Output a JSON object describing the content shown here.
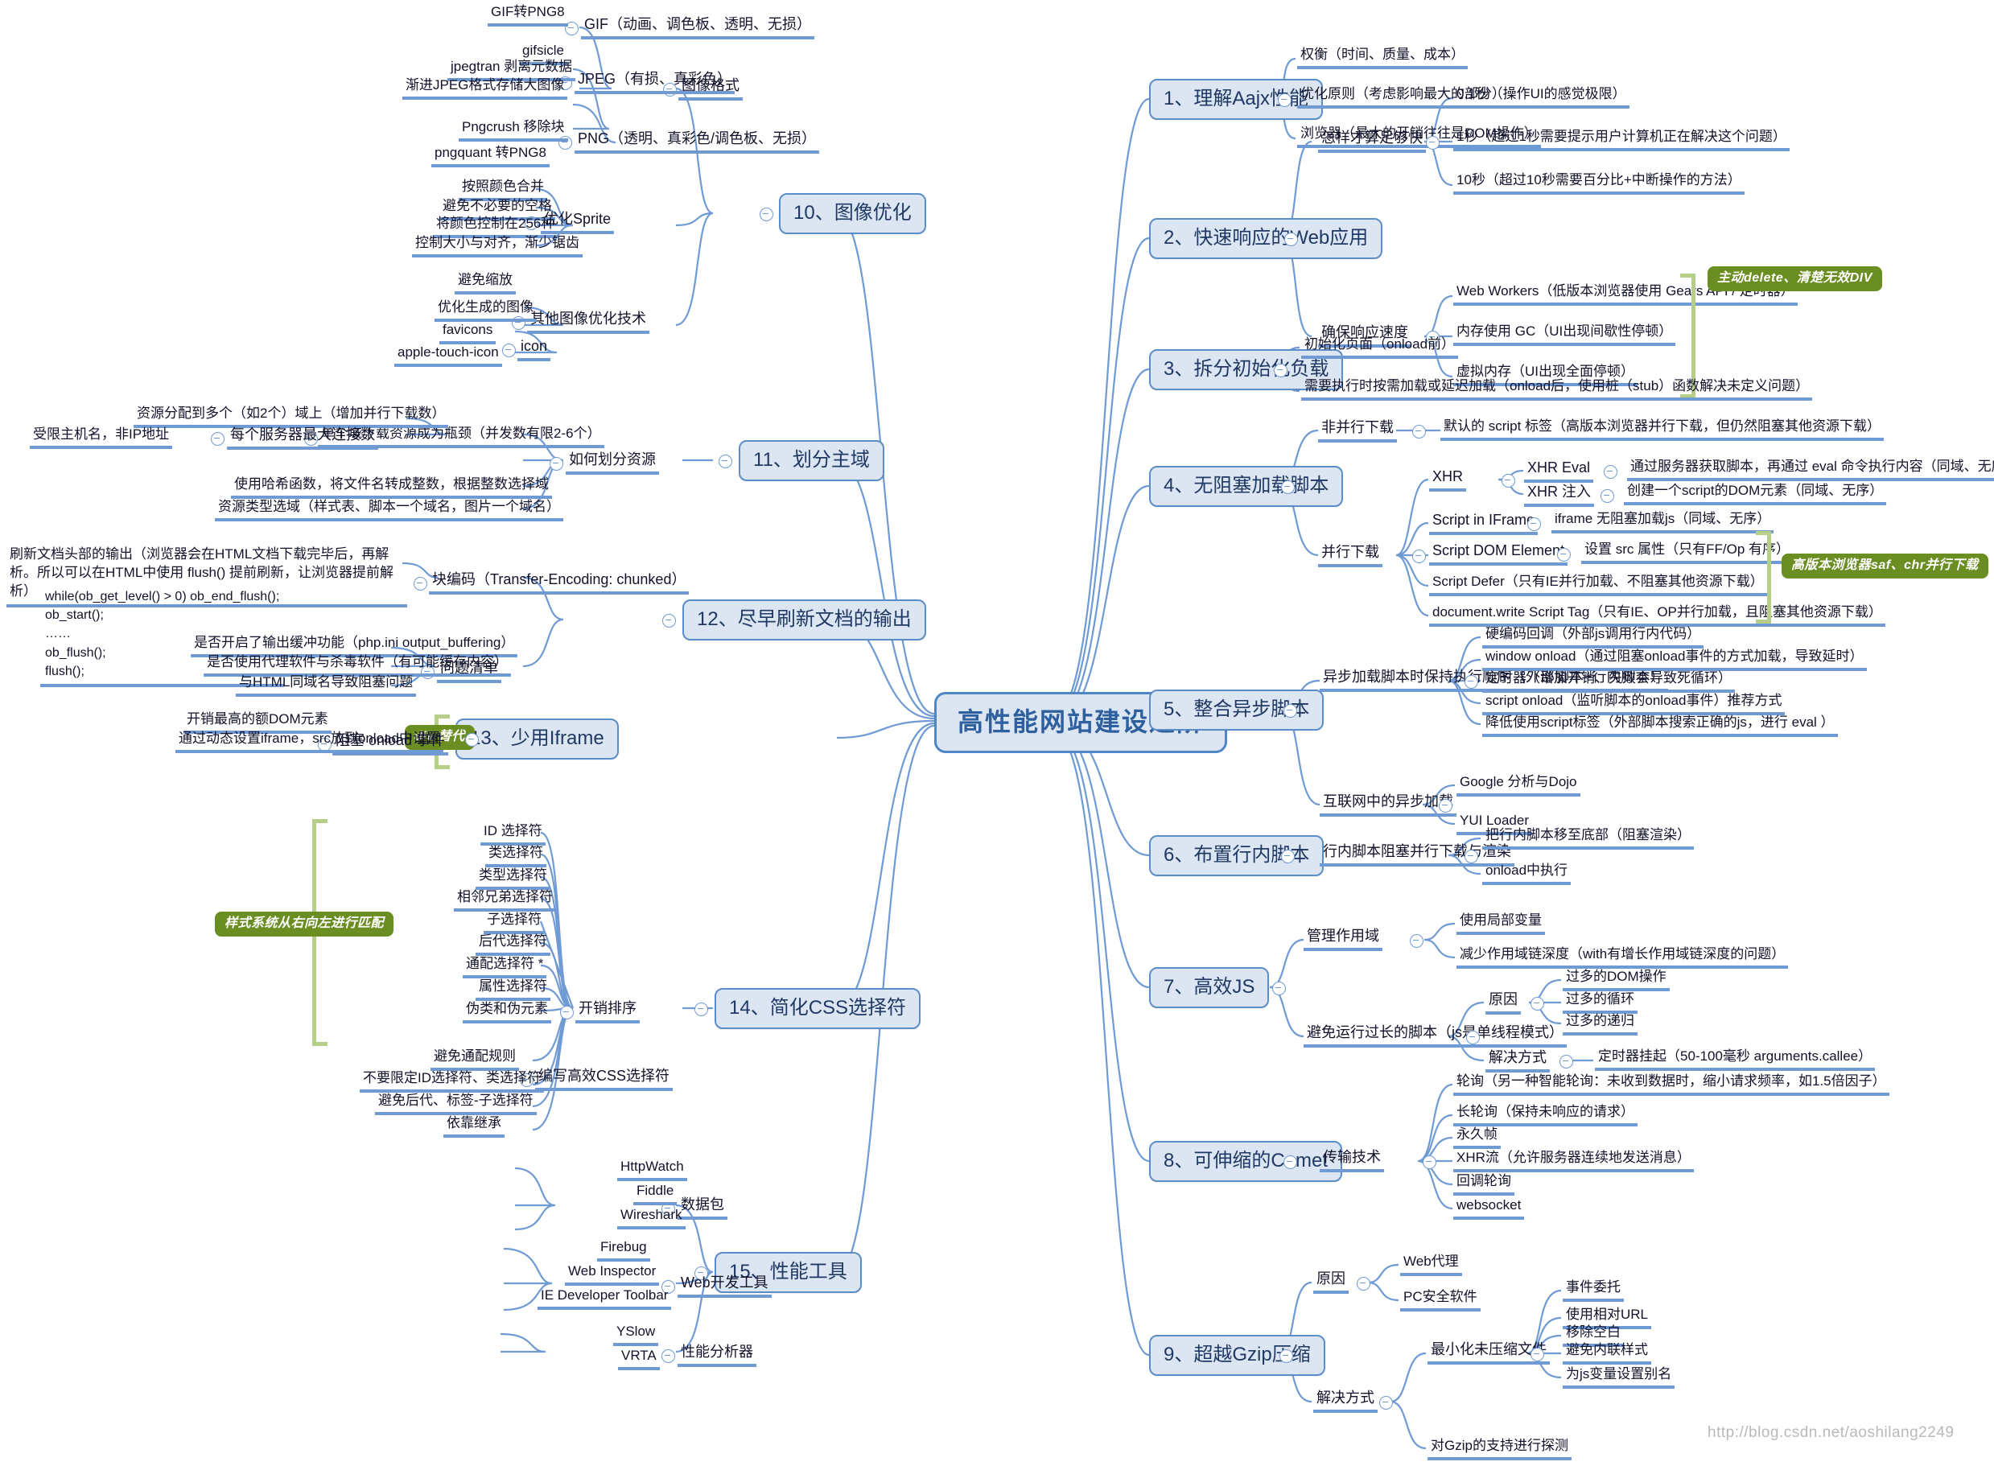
{
  "root": {
    "label": "高性能网站建设进阶"
  },
  "colors": {
    "branch": "#6f9ad3",
    "topic_fill": "#dce6f2",
    "topic_border": "#5b8dc8",
    "note_fill": "#6b8e23",
    "bracket": "#b5cf89",
    "root_text": "#2e5f9e"
  },
  "watermark": "http://blog.csdn.net/aoshilang2249",
  "topics": {
    "t1": "1、理解Aajx性能",
    "t2": "2、快速响应的Web应用",
    "t3": "3、拆分初始化负载",
    "t4": "4、无阻塞加载脚本",
    "t5": "5、整合异步脚本",
    "t6": "6、布置行内脚本",
    "t7": "7、高效JS",
    "t8": "8、可伸缩的Comet",
    "t9": "9、超越Gzip压缩",
    "t10": "10、图像优化",
    "t11": "11、划分主域",
    "t12": "12、尽早刷新文档的输出",
    "t13": "13、少用Iframe",
    "t14": "14、简化CSS选择符",
    "t15": "15、性能工具"
  },
  "b1": {
    "items": [
      "权衡（时间、质量、成本）",
      "优化原则（考虑影响最大的部分）",
      "浏览器（最大的开销往往是DOM操作）"
    ]
  },
  "b2": {
    "sub1": "怎样才算足够快",
    "sub1_items": [
      "0.1秒（操作UI的感觉极限）",
      "1秒（超过1秒需要提示用户计算机正在解决这个问题）",
      "10秒（超过10秒需要百分比+中断操作的方法）"
    ],
    "sub2": "确保响应速度",
    "sub2_items": [
      "Web Workers（低版本浏览器使用 Gears API / 定时器）",
      "内存使用 GC（UI出现间歇性停顿）",
      "虚拟内存（UI出现全面停顿）"
    ],
    "note": "主动delete、清楚无效DIV"
  },
  "b3": {
    "items": [
      "初始化页面（onload前）",
      "需要执行时按需加载或延迟加载（onload后，使用桩（stub）函数解决未定义问题）"
    ]
  },
  "b4": {
    "sub1": "非并行下载",
    "sub1_items": [
      "默认的 script 标签（高版本浏览器并行下载，但仍然阻塞其他资源下载）"
    ],
    "sub2": "并行下载",
    "xhr_label": "XHR",
    "xhr_children": [
      {
        "label": "XHR Eval",
        "desc": "通过服务器获取脚本，再通过 eval 命令执行内容（同域、无序）"
      },
      {
        "label": "XHR 注入",
        "desc": "创建一个script的DOM元素（同域、无序）"
      }
    ],
    "rows": [
      {
        "label": "Script in IFrame",
        "desc": "iframe 无阻塞加载js（同域、无序）"
      },
      {
        "label": "Script DOM Element",
        "desc": "设置 src 属性（只有FF/Op 有序）"
      }
    ],
    "plain": [
      "Script Defer（只有IE并行加载、不阻塞其他资源下载）",
      "document.write Script Tag（只有IE、OP并行加载，且阻塞其他资源下载）"
    ],
    "note": "高版本浏览器saf、chr并行下载"
  },
  "b5": {
    "sub1": "异步加载脚本时保持执行顺序（外部脚本+行内脚本）",
    "sub1_items": [
      "硬编码回调（外部js调用行内代码）",
      "window onload（通过阻塞onload事件的方式加载，导致延时）",
      "定时器（增加开销、失败会导致死循环）",
      "script onload（监听脚本的onload事件）推荐方式",
      "降低使用script标签（外部脚本搜索正确的js，进行 eval ）"
    ],
    "sub2": "互联网中的异步加载",
    "sub2_items": [
      "Google 分析与Dojo",
      "YUI Loader"
    ]
  },
  "b6": {
    "sub1": "行内脚本阻塞并行下载与渲染",
    "sub1_items": [
      "把行内脚本移至底部（阻塞渲染）",
      "onload中执行"
    ]
  },
  "b7": {
    "sub1": "管理作用域",
    "sub1_items": [
      "使用局部变量",
      "减少作用域链深度（with有增长作用域链深度的问题）"
    ],
    "sub2": "避免运行过长的脚本（js是单线程模式）",
    "cause_label": "原因",
    "cause_items": [
      "过多的DOM操作",
      "过多的循环",
      "过多的递归"
    ],
    "fix_label": "解决方式",
    "fix_items": [
      "定时器挂起（50-100毫秒 arguments.callee）"
    ]
  },
  "b8": {
    "sub1": "传输技术",
    "sub1_items": [
      "轮询（另一种智能轮询：未收到数据时，缩小请求频率，如1.5倍因子）",
      "长轮询（保持未响应的请求）",
      "永久帧",
      "XHR流（允许服务器连续地发送消息）",
      "回调轮询",
      "websocket"
    ]
  },
  "b9": {
    "cause_label": "原因",
    "cause_items": [
      "Web代理",
      "PC安全软件"
    ],
    "fix_label": "解决方式",
    "fix_sub": "最小化未压缩文件",
    "fix_sub_items": [
      "事件委托",
      "使用相对URL",
      "移除空白",
      "避免内联样式",
      "为js变量设置别名"
    ],
    "fix_items": [
      "对Gzip的支持进行探测"
    ]
  },
  "b10": {
    "sub1": "图像格式",
    "sub1_items": [
      {
        "label": "GIF（动画、调色板、透明、无损）",
        "children": [
          "GIF转PNG8",
          "gifsicle"
        ]
      },
      {
        "label": "JPEG（有损、真彩色）",
        "children": [
          "jpegtran 剥离元数据",
          "渐进JPEG格式存储大图像"
        ]
      },
      {
        "label": "PNG（透明、真彩色/调色板、无损）",
        "children": [
          "Pngcrush 移除块",
          "pngquant 转PNG8"
        ]
      }
    ],
    "sub2": "优化Sprite",
    "sub2_items": [
      "按照颜色合并",
      "避免不必要的空格",
      "将颜色控制在256种",
      "控制大小与对齐，渐少锯齿"
    ],
    "sub3": "其他图像优化技术",
    "sub3_items": [
      "避免缩放",
      "优化生成的图像"
    ],
    "icon_label": "icon",
    "icon_items": [
      "favicons",
      "apple-touch-icon"
    ]
  },
  "b11": {
    "sub1": "如何划分资源",
    "sub1_items": [
      "单个域下载资源成为瓶颈（并发数有限2-6个）",
      "使用哈希函数，将文件名转成整数，根据整数选择域",
      "资源类型选域（样式表、脚本一个域名，图片一个域名）"
    ],
    "bottleneck_children": [
      "资源分配到多个（如2个）域上（增加并行下载数）",
      "每个服务器最大连接数"
    ],
    "conn_child": "受限主机名，非IP地址"
  },
  "b12": {
    "sub1": "块编码（Transfer-Encoding: chunked）",
    "sub1_item": "刷新文档头部的输出（浏览器会在HTML文档下载完毕后，再解析。所以可以在HTML中使用 flush() 提前刷新，让浏览器提前解析）",
    "code": "while(ob_get_level() > 0) ob_end_flush();\nob_start();\n……\nob_flush();\nflush();",
    "sub2": "问题清单",
    "sub2_items": [
      "是否开启了输出缓冲功能（php.ini output_buffering）",
      "是否使用代理软件与杀毒软件（有可能缓存内容）",
      "与HTML同域名导致阻塞问题"
    ]
  },
  "b13": {
    "sub1": "阻塞 onload 事件",
    "sub1_items": [
      "开销最高的额DOM元素",
      "通过动态设置iframe，src放到onload中设置"
    ],
    "note": "div 替代"
  },
  "b14": {
    "sub1": "开销排序",
    "sub1_items": [
      "ID 选择符",
      "类选择符",
      "类型选择符",
      "相邻兄弟选择符",
      "子选择符",
      "后代选择符",
      "通配选择符 *",
      "属性选择符",
      "伪类和伪元素"
    ],
    "note": "样式系统从右向左进行匹配",
    "sub2": "编写高效CSS选择符",
    "sub2_items": [
      "避免通配规则",
      "不要限定ID选择符、类选择符",
      "避免后代、标签-子选择符",
      "依靠继承"
    ]
  },
  "b15": {
    "sub1": "数据包",
    "sub1_items": [
      "HttpWatch",
      "Fiddle",
      "Wireshark"
    ],
    "sub2": "Web开发工具",
    "sub2_items": [
      "Firebug",
      "Web Inspector",
      "IE Developer Toolbar"
    ],
    "sub3": "性能分析器",
    "sub3_items": [
      "YSlow",
      "VRTA"
    ]
  }
}
